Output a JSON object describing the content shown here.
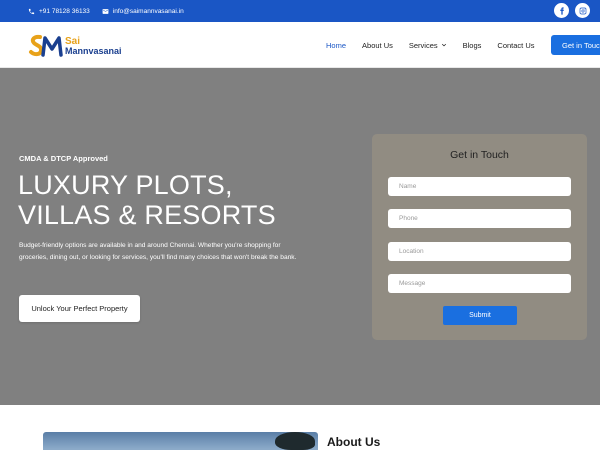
{
  "topbar": {
    "phone": "+91 78128 36133",
    "email": "info@saimannvasanai.in",
    "social": [
      {
        "icon": "facebook-icon"
      },
      {
        "icon": "instagram-icon"
      }
    ]
  },
  "header": {
    "logo_line1": "Sai",
    "logo_line2": "Mannvasanai",
    "nav": [
      {
        "label": "Home",
        "active": true
      },
      {
        "label": "About Us"
      },
      {
        "label": "Services",
        "dropdown": true
      },
      {
        "label": "Blogs"
      },
      {
        "label": "Contact Us"
      }
    ],
    "cta": "Get in Touch"
  },
  "hero": {
    "badge": "CMDA & DTCP Approved",
    "headline_line1": "LUXURY PLOTS,",
    "headline_line2": "VILLAS & RESORTS",
    "description": "Budget-friendly options are available in and around Chennai. Whether you're shopping for groceries, dining out, or looking for services, you'll find many choices that won't break the bank.",
    "button": "Unlock Your Perfect Property"
  },
  "form": {
    "title": "Get in Touch",
    "fields": [
      {
        "placeholder": "Name"
      },
      {
        "placeholder": "Phone"
      },
      {
        "placeholder": "Location"
      },
      {
        "placeholder": "Message"
      }
    ],
    "submit": "Submit"
  },
  "about": {
    "title": "About Us"
  },
  "colors": {
    "primary": "#1a56c5",
    "button": "#1a6fe0",
    "hero_bg": "#808080",
    "card_bg": "#918c82",
    "logo_orange": "#e8a21a",
    "logo_navy": "#1a3f8f"
  }
}
